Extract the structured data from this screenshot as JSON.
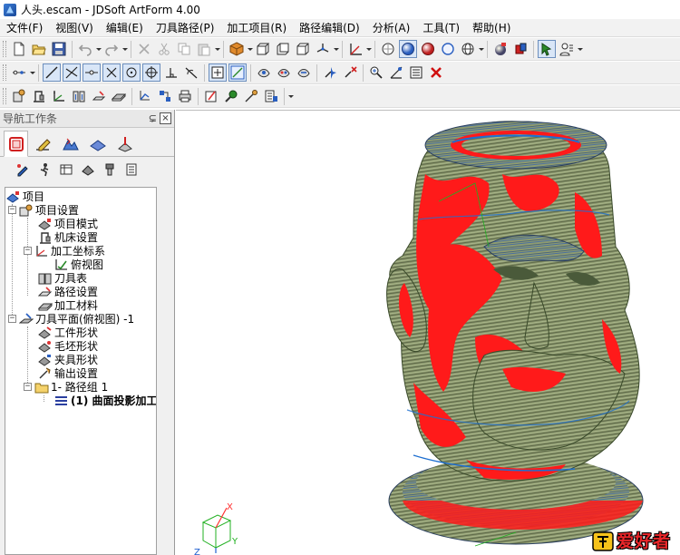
{
  "window": {
    "title": "人头.escam - JDSoft ArtForm 4.00"
  },
  "menu": [
    "文件(F)",
    "视图(V)",
    "编辑(E)",
    "刀具路径(P)",
    "加工项目(R)",
    "路径编辑(D)",
    "分析(A)",
    "工具(T)",
    "帮助(H)"
  ],
  "nav": {
    "title": "导航工作条",
    "pin": "⊊",
    "close": "×"
  },
  "tree": {
    "nodes": [
      {
        "label": "项目",
        "icon": "project-icon"
      },
      {
        "label": "项目设置",
        "icon": "project-settings-icon"
      },
      {
        "label": "项目模式",
        "icon": "project-mode-icon"
      },
      {
        "label": "机床设置",
        "icon": "machine-settings-icon"
      },
      {
        "label": "加工坐标系",
        "icon": "coordinate-system-icon"
      },
      {
        "label": "俯视图",
        "icon": "top-view-icon"
      },
      {
        "label": "刀具表",
        "icon": "tool-table-icon"
      },
      {
        "label": "路径设置",
        "icon": "path-settings-icon"
      },
      {
        "label": "加工材料",
        "icon": "material-icon"
      },
      {
        "label": "刀具平面(俯视图) -1",
        "icon": "tool-plane-icon"
      },
      {
        "label": "工件形状",
        "icon": "workpiece-shape-icon"
      },
      {
        "label": "毛坯形状",
        "icon": "blank-shape-icon"
      },
      {
        "label": "夹具形状",
        "icon": "fixture-shape-icon"
      },
      {
        "label": "输出设置",
        "icon": "output-settings-icon"
      },
      {
        "label": "1- 路径组 1",
        "icon": "folder-icon"
      },
      {
        "label": "(1) 曲面投影加工",
        "icon": "toolpath-icon"
      }
    ]
  },
  "viewport": {
    "axis_labels": {
      "x": "X",
      "y": "Y",
      "z": "Z"
    },
    "colors": {
      "surface": "#8e9b6f",
      "highlight": "#ff1a1a",
      "path": "#1e6fd0",
      "axis_x": "#ff3030",
      "axis_y": "#20b020"
    }
  },
  "watermark": {
    "text": "爱好者"
  }
}
